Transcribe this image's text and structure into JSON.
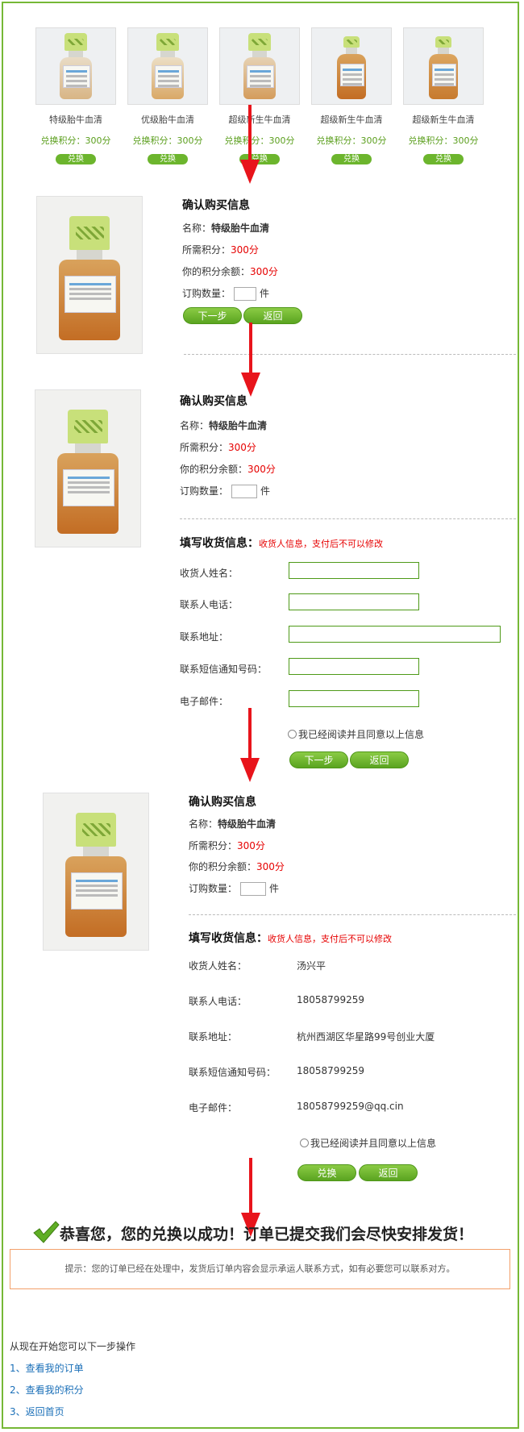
{
  "products": [
    {
      "name": "特级胎牛血清",
      "points": "兑换积分：300分",
      "button": "兑换"
    },
    {
      "name": "优级胎牛血清",
      "points": "兑换积分：300分",
      "button": "兑换"
    },
    {
      "name": "超级新生牛血清",
      "points": "兑换积分：300分",
      "button": "兑换"
    },
    {
      "name": "超级新生牛血清",
      "points": "兑换积分：300分",
      "button": "兑换"
    },
    {
      "name": "超级新生牛血清",
      "points": "兑换积分：300分",
      "button": "兑换"
    }
  ],
  "confirm": {
    "title": "确认购买信息",
    "name_label": "名称：",
    "name_value": "特级胎牛血清",
    "required_label": "所需积分：",
    "required_value": "300分",
    "balance_label": "你的积分余额：",
    "balance_value": "300分",
    "qty_label": "订购数量：",
    "qty_unit": "件"
  },
  "step1_buttons": {
    "next": "下一步",
    "back": "返回"
  },
  "shipping": {
    "title": "填写收货信息：",
    "note": "收货人信息，支付后不可以修改",
    "fields": [
      {
        "label": "收货人姓名：",
        "value": "汤兴平"
      },
      {
        "label": "联系人电话：",
        "value": "18058799259"
      },
      {
        "label": "联系地址：",
        "value": "杭州西湖区华星路99号创业大厦"
      },
      {
        "label": "联系短信通知号码：",
        "value": "18058799259"
      },
      {
        "label": "电子邮件：",
        "value": "18058799259@qq.cin"
      }
    ],
    "agree": "我已经阅读并且同意以上信息"
  },
  "step2_buttons": {
    "next": "下一步",
    "back": "返回"
  },
  "step3_buttons": {
    "exchange": "兑换",
    "back": "返回"
  },
  "success": {
    "message": "恭喜您，您的兑换以成功！订单已提交我们会尽快安排发货！",
    "notice": "提示：您的订单已经在处理中，发货后订单内容会显示承运人联系方式，如有必要您可以联系对方。"
  },
  "next_steps": {
    "heading": "从现在开始您可以下一步操作",
    "links": [
      "1、查看我的订单",
      "2、查看我的积分",
      "3、返回首页"
    ]
  },
  "colors": {
    "accent": "#6cb52d",
    "red": "#e60000",
    "arrow": "#e8141b",
    "link": "#1a6fb8"
  }
}
